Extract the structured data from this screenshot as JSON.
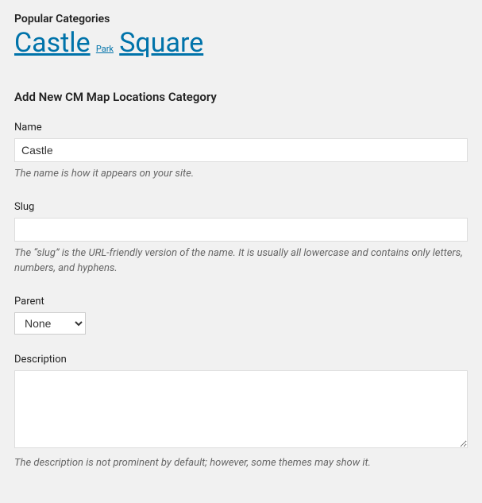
{
  "popular": {
    "heading": "Popular Categories",
    "tags": [
      {
        "label": "Castle",
        "size": "large"
      },
      {
        "label": "Park",
        "size": "small"
      },
      {
        "label": "Square",
        "size": "large"
      }
    ]
  },
  "form": {
    "heading": "Add New CM Map Locations Category",
    "name": {
      "label": "Name",
      "value": "Castle",
      "help": "The name is how it appears on your site."
    },
    "slug": {
      "label": "Slug",
      "value": "",
      "help": "The “slug” is the URL-friendly version of the name. It is usually all lowercase and contains only letters, numbers, and hyphens."
    },
    "parent": {
      "label": "Parent",
      "selected": "None"
    },
    "description": {
      "label": "Description",
      "value": "",
      "help": "The description is not prominent by default; however, some themes may show it."
    }
  }
}
